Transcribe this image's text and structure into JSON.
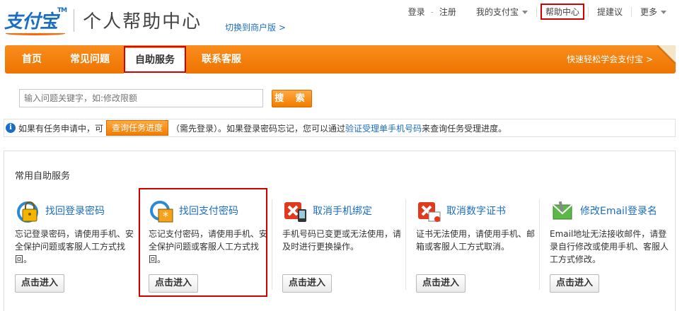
{
  "header": {
    "logo_text": "支付宝",
    "logo_tm": "TM",
    "title": "个人帮助中心",
    "switch_link": "切换到商户版 >"
  },
  "topnav": {
    "login": "登录",
    "separator": "-",
    "register": "注册",
    "my_alipay": "我的支付宝",
    "help_center": "帮助中心",
    "suggest": "提建议",
    "more": "更多"
  },
  "mainnav": {
    "tabs": [
      {
        "label": "首页"
      },
      {
        "label": "常见问题"
      },
      {
        "label": "自助服务"
      },
      {
        "label": "联系客服"
      }
    ],
    "active_tab": "自助服务",
    "quick_link": "快速轻松学会支付宝 >"
  },
  "search": {
    "placeholder": "输入问题关键字，如:修改限额",
    "button_label": "搜 索"
  },
  "infobar": {
    "text_before": "如果有任务申请中，可",
    "query_button": "查询任务进度",
    "text_middle": "（需先登录）。如果登录密码忘记，您可以通过",
    "link": "验证受理单手机号码",
    "text_after": "来查询任务受理进度。"
  },
  "panel": {
    "title": "常用自助服务",
    "services": [
      {
        "name": "找回登录密码",
        "icon": "lock-refresh-icon",
        "desc": "忘记登录密码，请使用手机、安全保护问题或客服人工方式找回。",
        "button": "点击进入"
      },
      {
        "name": "找回支付密码",
        "icon": "password-refresh-icon",
        "desc": "忘记支付密码，请使用手机、安全保护问题或客服人工方式找回。",
        "button": "点击进入"
      },
      {
        "name": "取消手机绑定",
        "icon": "phone-cancel-icon",
        "desc": "手机号码已变更或无法使用，请及时进行更换操作。",
        "button": "点击进入"
      },
      {
        "name": "取消数字证书",
        "icon": "certificate-cancel-icon",
        "desc": "证书无法使用，请使用手机、邮箱或客服人工方式取消。",
        "button": "点击进入"
      },
      {
        "name": "修改Email登录名",
        "icon": "email-edit-icon",
        "desc": "Email地址无法接收邮件，请登录自行修改或使用手机、客服人工方式修改。",
        "button": "点击进入"
      }
    ]
  },
  "colors": {
    "brand_blue": "#1b6ec2",
    "brand_orange": "#f27c00",
    "highlight_red": "#d40000"
  }
}
